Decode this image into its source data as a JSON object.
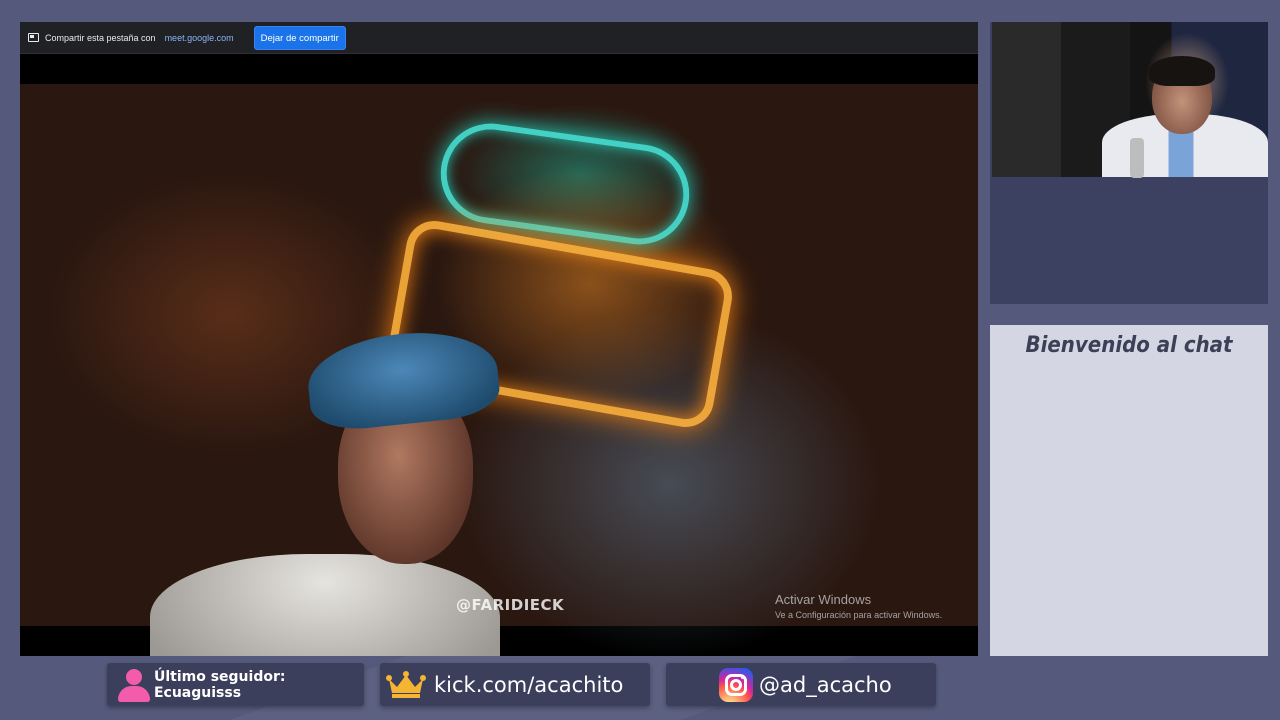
{
  "share_bar": {
    "share_text": "Compartir esta pestaña con",
    "domain": "meet.google.com",
    "stop_button": "Dejar de compartir"
  },
  "video": {
    "watermark": "@FARIDIECK",
    "activate_windows_title": "Activar Windows",
    "activate_windows_subtitle": "Ve a Configuración para activar Windows."
  },
  "chat": {
    "title": "Bienvenido al chat"
  },
  "bottom_bar": {
    "last_follower": "Último seguidor: Ecuaguisss",
    "kick": "kick.com/acachito",
    "instagram": "@ad_acacho"
  },
  "colors": {
    "background": "#555a7c",
    "panel": "#3b3f5c",
    "accent_pink": "#f25caa",
    "crown": "#f5b431",
    "meet_blue": "#1a73e8"
  },
  "icons": [
    "tab-share-icon",
    "person-icon",
    "crown-icon",
    "instagram-icon"
  ]
}
